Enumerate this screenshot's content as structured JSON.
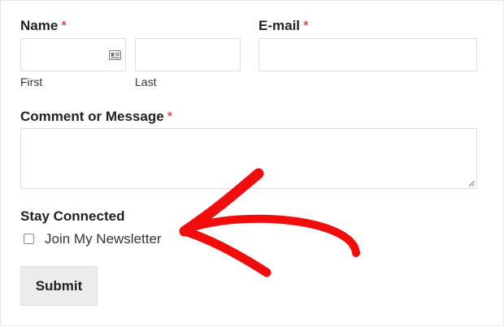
{
  "form": {
    "name_label": "Name",
    "email_label": "E-mail",
    "required_mark": "*",
    "first_sublabel": "First",
    "last_sublabel": "Last",
    "comment_label": "Comment or Message",
    "stay_connected_label": "Stay Connected",
    "newsletter_label": "Join My Newsletter",
    "newsletter_checked": false,
    "submit_label": "Submit"
  },
  "icons": {
    "name_field_icon": "contact-card-icon",
    "resize_handle": "resize-handle-icon",
    "annotation": "red-arrow-icon"
  },
  "colors": {
    "required": "#e02020",
    "annotation_arrow": "#f20d0d",
    "button_bg": "#ececec",
    "field_border": "#dcdcdc"
  }
}
